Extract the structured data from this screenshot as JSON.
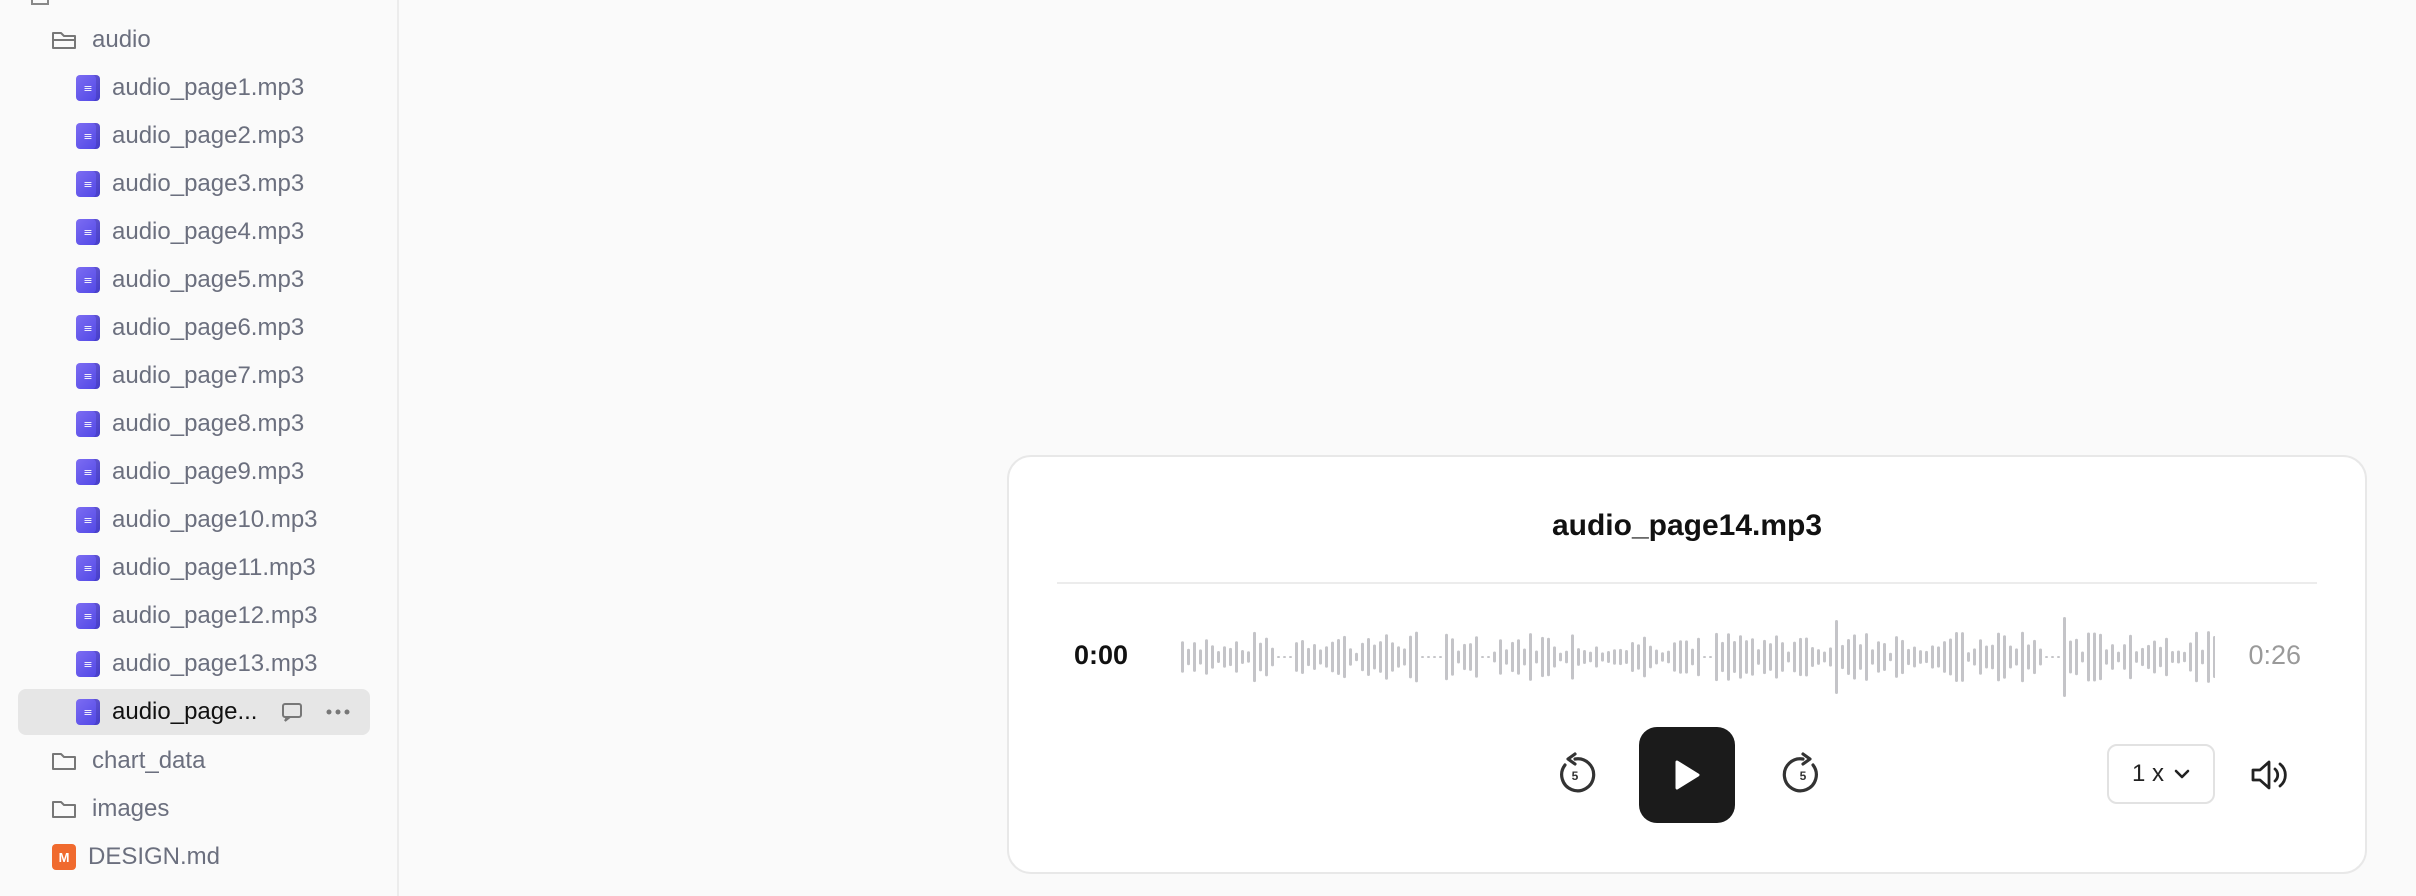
{
  "sidebar": {
    "folder_audio": "audio",
    "files": [
      "audio_page1.mp3",
      "audio_page2.mp3",
      "audio_page3.mp3",
      "audio_page4.mp3",
      "audio_page5.mp3",
      "audio_page6.mp3",
      "audio_page7.mp3",
      "audio_page8.mp3",
      "audio_page9.mp3",
      "audio_page10.mp3",
      "audio_page11.mp3",
      "audio_page12.mp3",
      "audio_page13.mp3"
    ],
    "selected_file": "audio_page...",
    "folder_chart": "chart_data",
    "folder_images": "images",
    "design_file": "DESIGN.md",
    "design_icon_letter": "M"
  },
  "player": {
    "title": "audio_page14.mp3",
    "current_time": "0:00",
    "total_time": "0:26",
    "progress": 0,
    "skip_back_seconds": "5",
    "skip_forward_seconds": "5",
    "speed": "1 x"
  },
  "icons": {
    "folder": "folder-icon",
    "file": "audio-file-icon",
    "play": "play-icon",
    "rewind": "rewind-5-icon",
    "forward": "forward-5-icon",
    "volume": "volume-icon"
  },
  "colors": {
    "accent": "#5b4ee8",
    "play_bg": "#1b1b1b",
    "waveform": "#c4c4c8"
  }
}
